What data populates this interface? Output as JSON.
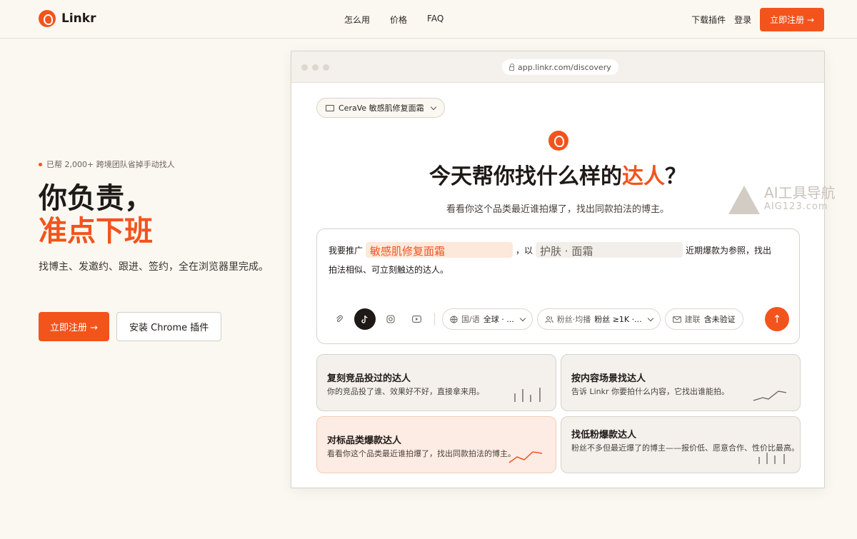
{
  "nav": {
    "brand": "Linkr",
    "links": [
      "怎么用",
      "价格",
      "FAQ"
    ],
    "download": "下载插件",
    "login": "登录",
    "signup": "立即注册 →"
  },
  "hero": {
    "tagline": "已帮 2,000+ 跨境团队省掉手动找人",
    "title_line1": "你负责，",
    "title_line2": "准点下班",
    "subtitle": "找博主、发邀约、跟进、签约，全在浏览器里完成。",
    "signup_button": "立即注册 →",
    "install_button": "安装 Chrome 插件"
  },
  "browser": {
    "url": "app.linkr.com/discovery",
    "project": "CeraVe 敏感肌修复面霜",
    "question_prefix": "今天帮你找什么样的",
    "question_accent": "达人",
    "question_suffix": "？",
    "question_sub": "看看你这个品类最近谁拍爆了，找出同款拍法的博主。",
    "prompt": {
      "p1": "我要推广",
      "chip1": "敏感肌修复面霜",
      "p2": "，以",
      "chip2": "护肤 · 面霜",
      "p3": "近期爆款为参照，找出",
      "p4": "拍法相似、可立刻触达的达人。"
    },
    "filters": {
      "region_label": "国/语",
      "region_value": "全球 · ...",
      "fans_label": "粉丝·均播",
      "fans_value": "粉丝 ≥1K ·...",
      "contact_label": "建联",
      "contact_value": "含未验证"
    },
    "send": "↑",
    "cards": [
      {
        "title": "复刻竞品投过的达人",
        "desc": "你的竞品投了谁、效果好不好，直接拿来用。"
      },
      {
        "title": "按内容场景找达人",
        "desc": "告诉 Linkr 你要拍什么内容，它找出谁能拍。"
      },
      {
        "title": "对标品类爆款达人",
        "desc": "看看你这个品类最近谁拍爆了，找出同款拍法的博主。"
      },
      {
        "title": "找低粉爆款达人",
        "desc": "粉丝不多但最近爆了的博主——报价低、愿意合作、性价比最高。"
      }
    ]
  },
  "watermark": {
    "line1": "AI工具导航",
    "line2": "AIG123.com"
  },
  "colors": {
    "accent": "#f2541c",
    "background": "#fbf8f2"
  }
}
